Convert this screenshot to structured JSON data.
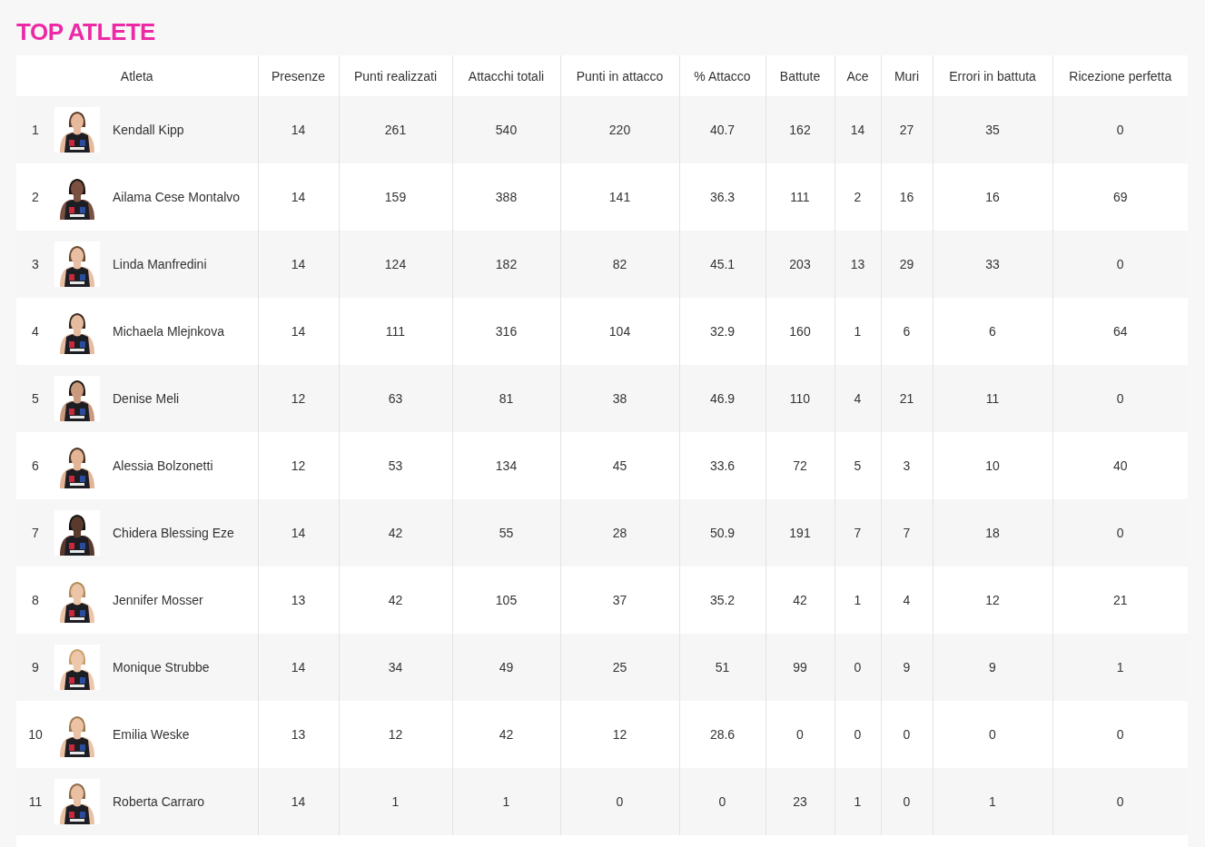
{
  "title": "TOP ATLETE",
  "table": {
    "columns": [
      "Atleta",
      "Presenze",
      "Punti realizzati",
      "Attacchi totali",
      "Punti in attacco",
      "% Attacco",
      "Battute",
      "Ace",
      "Muri",
      "Errori in battuta",
      "Ricezione perfetta"
    ],
    "rows": [
      {
        "cells": [
          {
            "rank": "1",
            "name": "Kendall Kipp"
          },
          "14",
          "261",
          "540",
          "220",
          "40.7",
          "162",
          "14",
          "27",
          "35",
          "0"
        ]
      },
      {
        "cells": [
          {
            "rank": "2",
            "name": "Ailama Cese Montalvo"
          },
          "14",
          "159",
          "388",
          "141",
          "36.3",
          "111",
          "2",
          "16",
          "16",
          "69"
        ]
      },
      {
        "cells": [
          {
            "rank": "3",
            "name": "Linda Manfredini"
          },
          "14",
          "124",
          "182",
          "82",
          "45.1",
          "203",
          "13",
          "29",
          "33",
          "0"
        ]
      },
      {
        "cells": [
          {
            "rank": "4",
            "name": "Michaela Mlejnkova"
          },
          "14",
          "111",
          "316",
          "104",
          "32.9",
          "160",
          "1",
          "6",
          "6",
          "64"
        ]
      },
      {
        "cells": [
          {
            "rank": "5",
            "name": "Denise Meli"
          },
          "12",
          "63",
          "81",
          "38",
          "46.9",
          "110",
          "4",
          "21",
          "11",
          "0"
        ]
      },
      {
        "cells": [
          {
            "rank": "6",
            "name": "Alessia Bolzonetti"
          },
          "12",
          "53",
          "134",
          "45",
          "33.6",
          "72",
          "5",
          "3",
          "10",
          "40"
        ]
      },
      {
        "cells": [
          {
            "rank": "7",
            "name": "Chidera Blessing Eze"
          },
          "14",
          "42",
          "55",
          "28",
          "50.9",
          "191",
          "7",
          "7",
          "18",
          "0"
        ]
      },
      {
        "cells": [
          {
            "rank": "8",
            "name": "Jennifer Mosser"
          },
          "13",
          "42",
          "105",
          "37",
          "35.2",
          "42",
          "1",
          "4",
          "12",
          "21"
        ]
      },
      {
        "cells": [
          {
            "rank": "9",
            "name": "Monique Strubbe"
          },
          "14",
          "34",
          "49",
          "25",
          "51",
          "99",
          "0",
          "9",
          "9",
          "1"
        ]
      },
      {
        "cells": [
          {
            "rank": "10",
            "name": "Emilia Weske"
          },
          "13",
          "12",
          "42",
          "12",
          "28.6",
          "0",
          "0",
          "0",
          "0",
          "0"
        ]
      },
      {
        "cells": [
          {
            "rank": "11",
            "name": "Roberta Carraro"
          },
          "14",
          "1",
          "1",
          "0",
          "0",
          "23",
          "1",
          "0",
          "1",
          "0"
        ]
      }
    ]
  }
}
